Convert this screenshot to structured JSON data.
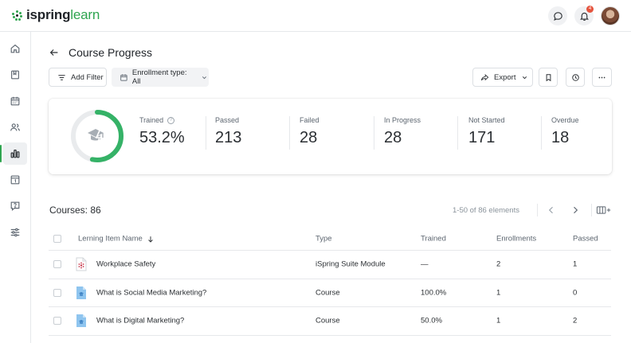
{
  "brand": {
    "part1": "ispring",
    "part2": "learn",
    "accent": "#2ea44f"
  },
  "header": {
    "notifications_count": "4"
  },
  "sidebar": {
    "items": [
      {
        "icon": "home-icon"
      },
      {
        "icon": "book-icon"
      },
      {
        "icon": "calendar-icon"
      },
      {
        "icon": "users-icon"
      },
      {
        "icon": "bar-chart-icon",
        "active": true
      },
      {
        "icon": "calendar-day-icon"
      },
      {
        "icon": "help-chat-icon"
      },
      {
        "icon": "sliders-icon"
      }
    ]
  },
  "page": {
    "title": "Course Progress"
  },
  "toolbar": {
    "add_filter": "Add Filter",
    "enrollment_filter": "Enrollment type: All",
    "export": "Export"
  },
  "stats": {
    "trained_label": "Trained",
    "trained_value": "53.2%",
    "trained_fraction": 0.532,
    "help_glyph": "?",
    "passed_label": "Passed",
    "passed_value": "213",
    "failed_label": "Failed",
    "failed_value": "28",
    "in_progress_label": "In Progress",
    "in_progress_value": "28",
    "not_started_label": "Not Started",
    "not_started_value": "171",
    "overdue_label": "Overdue",
    "overdue_value": "18"
  },
  "courses": {
    "count_label": "Courses: 86",
    "pagination": "1-50 of 86 elements"
  },
  "table": {
    "headers": {
      "name": "Lerning Item Name",
      "type": "Type",
      "trained": "Trained",
      "enrollments": "Enrollments",
      "passed": "Passed"
    },
    "rows": [
      {
        "name": "Workplace Safety",
        "type": "iSpring Suite Module",
        "trained": "—",
        "enrollments": "2",
        "passed": "1",
        "icon": "module-icon"
      },
      {
        "name": "What is Social Media Marketing?",
        "type": "Course",
        "trained": "100.0%",
        "enrollments": "1",
        "passed": "0",
        "icon": "course-icon"
      },
      {
        "name": "What is Digital Marketing?",
        "type": "Course",
        "trained": "50.0%",
        "enrollments": "1",
        "passed": "2",
        "icon": "course-icon"
      }
    ]
  }
}
